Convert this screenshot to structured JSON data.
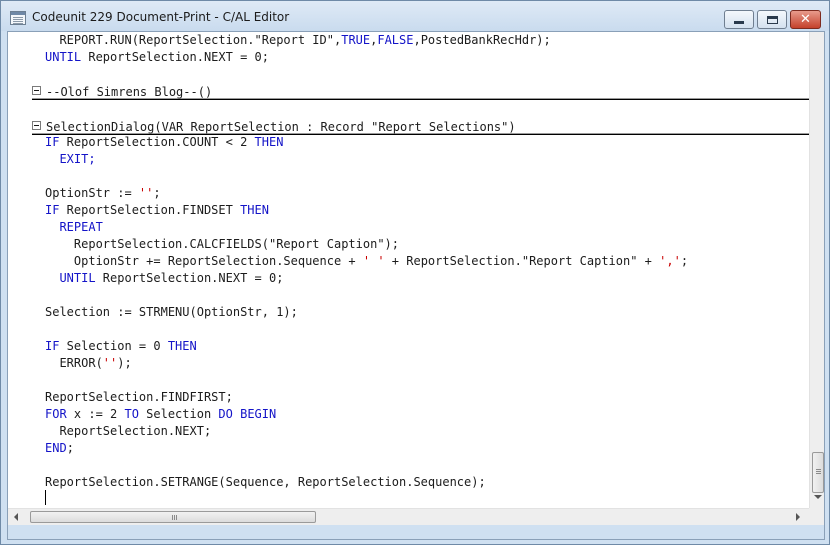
{
  "window": {
    "title": "Codeunit 229 Document-Print - C/AL Editor",
    "buttons": {
      "minimize": "minimize",
      "maximize": "maximize",
      "close": "✕"
    }
  },
  "editor": {
    "line_1": {
      "a": "  REPORT.RUN(ReportSelection.\"Report ID\",",
      "b": "TRUE",
      "c": ",",
      "d": "FALSE",
      "e": ",PostedBankRecHdr);"
    },
    "line_2": {
      "a": "UNTIL",
      "b": " ReportSelection.NEXT = 0;"
    },
    "section_1": "--Olof Simrens Blog--()",
    "section_2": "SelectionDialog(VAR ReportSelection : Record \"Report Selections\")",
    "line_3": {
      "a": "IF",
      "b": " ReportSelection.COUNT < 2 ",
      "c": "THEN"
    },
    "line_4": {
      "a": "  EXIT;"
    },
    "line_5": {
      "a": "OptionStr := ",
      "b": "''",
      "c": ";"
    },
    "line_6": {
      "a": "IF",
      "b": " ReportSelection.FINDSET ",
      "c": "THEN"
    },
    "line_7": {
      "a": "  REPEAT"
    },
    "line_8": {
      "a": "    ReportSelection.CALCFIELDS(\"Report Caption\");"
    },
    "line_9": {
      "a": "    OptionStr += ReportSelection.Sequence + ",
      "b": "' '",
      "c": " + ReportSelection.\"Report Caption\" + ",
      "d": "','",
      "e": ";"
    },
    "line_10": {
      "a": "  UNTIL",
      "b": " ReportSelection.NEXT = 0;"
    },
    "line_11": {
      "a": "Selection := STRMENU(OptionStr, 1);"
    },
    "line_12": {
      "a": "IF",
      "b": " Selection = 0 ",
      "c": "THEN"
    },
    "line_13": {
      "a": "  ERROR(",
      "b": "''",
      "c": ");"
    },
    "line_14": {
      "a": "ReportSelection.FINDFIRST;"
    },
    "line_15": {
      "a": "FOR",
      "b": " x := 2 ",
      "c": "TO",
      "d": " Selection ",
      "e": "DO BEGIN"
    },
    "line_16": {
      "a": "  ReportSelection.NEXT;"
    },
    "line_17": {
      "a": "END",
      "b": ";"
    },
    "line_18": {
      "a": "ReportSelection.SETRANGE(Sequence, ReportSelection.Sequence);"
    }
  },
  "colors": {
    "keyword": "#1414c8",
    "string": "#c80000",
    "text": "#1c1c1c",
    "frame": "#cfe0f1"
  },
  "icons": [
    "app-icon",
    "minimize-icon",
    "maximize-icon",
    "close-icon",
    "collapse-icon",
    "arrow-left-icon",
    "arrow-right-icon",
    "arrow-down-icon"
  ]
}
